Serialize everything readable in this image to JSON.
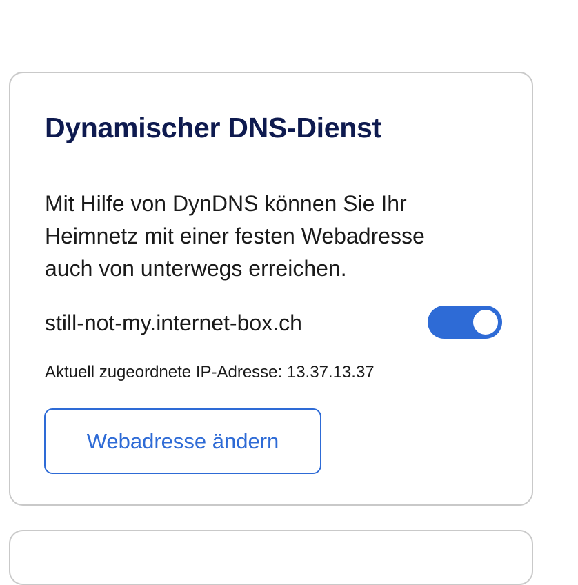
{
  "dyndns_card": {
    "title": "Dynamischer DNS-Dienst",
    "description": "Mit Hilfe von DynDNS können Sie Ihr Heimnetz mit einer festen Webadresse auch von unterwegs erreichen.",
    "hostname": "still-not-my.internet-box.ch",
    "toggle": {
      "state": "on",
      "accent_color": "#2e6bd6"
    },
    "ip_label": "Aktuell zugeordnete IP-Adresse: 13.37.13.37",
    "change_button_label": "Webadresse ändern"
  },
  "colors": {
    "title": "#0e1a4f",
    "accent": "#2e6bd6",
    "card_border": "#c9c9c9"
  }
}
